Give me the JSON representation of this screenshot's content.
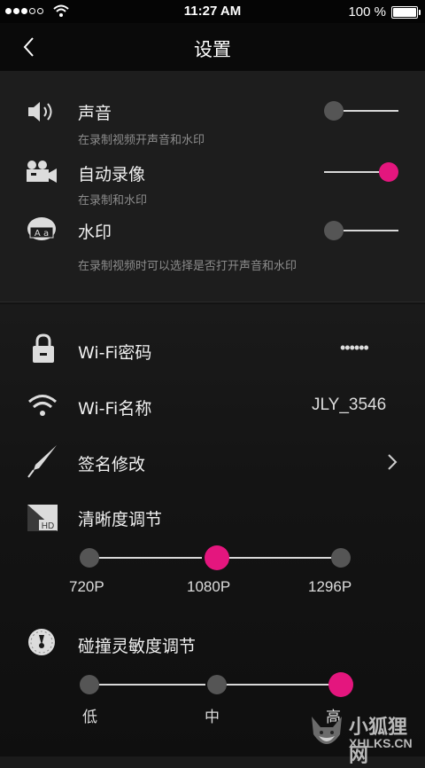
{
  "status_bar": {
    "time": "11:27 AM",
    "battery_text": "100 %",
    "signal_bars_filled": 3,
    "signal_bars_total": 5
  },
  "nav": {
    "title": "设置",
    "back_icon": "chevron-left-icon"
  },
  "recording": {
    "sound": {
      "label": "声音",
      "description": "在录制视频开声音和水印",
      "enabled": false,
      "icon": "speaker-icon"
    },
    "auto_record": {
      "label": "自动录像",
      "description": "在录制和水印",
      "enabled": true,
      "icon": "video-camera-icon"
    },
    "watermark": {
      "label": "水印",
      "description": "在录制视频时可以选择是否打开声音和水印",
      "enabled": false,
      "icon": "watermark-icon",
      "icon_text": "A a"
    }
  },
  "settings": {
    "wifi_password": {
      "label": "Wi-Fi密码",
      "value_masked": "••••••",
      "icon": "lock-icon"
    },
    "wifi_name": {
      "label": "Wi-Fi名称",
      "value": "JLY_3546",
      "icon": "wifi-icon"
    },
    "signature": {
      "label": "签名修改",
      "icon": "pen-icon",
      "chevron": "chevron-right-icon"
    },
    "resolution": {
      "label": "清晰度调节",
      "icon": "hd-icon",
      "icon_text": "HD",
      "options": [
        "720P",
        "1080P",
        "1296P"
      ],
      "selected_index": 1
    },
    "collision_sensitivity": {
      "label": "碰撞灵敏度调节",
      "icon": "gauge-icon",
      "options": [
        "低",
        "中",
        "高"
      ],
      "selected_index": 2
    }
  },
  "watermark_logo": {
    "text_cn": "小狐狸网",
    "text_en": "XHLKS.CN"
  },
  "colors": {
    "accent": "#e4167e",
    "inactive_knob": "#555555",
    "background": "#1b1b1b",
    "navbar": "#0a0a0a"
  }
}
